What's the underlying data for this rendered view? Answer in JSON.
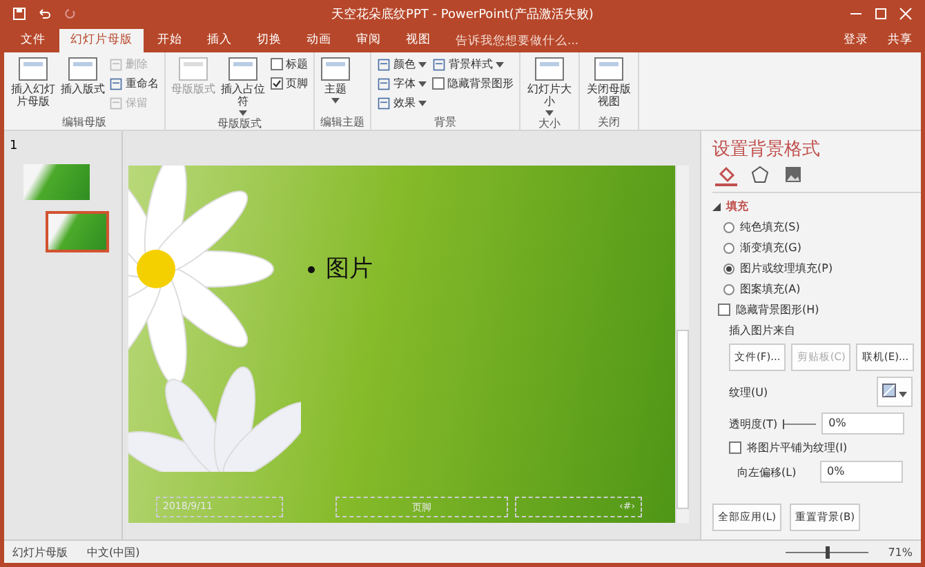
{
  "window": {
    "title": "天空花朵底纹PPT - PowerPoint(产品激活失败)"
  },
  "tabs": [
    {
      "label": "文件",
      "selected": false
    },
    {
      "label": "幻灯片母版",
      "selected": true
    },
    {
      "label": "开始",
      "selected": false
    },
    {
      "label": "插入",
      "selected": false
    },
    {
      "label": "切换",
      "selected": false
    },
    {
      "label": "动画",
      "selected": false
    },
    {
      "label": "审阅",
      "selected": false
    },
    {
      "label": "视图",
      "selected": false
    }
  ],
  "tell_me": {
    "placeholder": "告诉我您想要做什么..."
  },
  "account": {
    "login": "登录",
    "share": "共享"
  },
  "ribbon": [
    {
      "label": "编辑母版",
      "items": [
        {
          "kind": "large",
          "label": "插入幻灯片母版",
          "disabled": false
        },
        {
          "kind": "large",
          "label": "插入版式",
          "disabled": false
        },
        {
          "kind": "small",
          "label": "删除",
          "disabled": true
        },
        {
          "kind": "small",
          "label": "重命名",
          "disabled": false
        },
        {
          "kind": "small",
          "label": "保留",
          "disabled": true
        }
      ]
    },
    {
      "label": "母版版式",
      "items": [
        {
          "kind": "large",
          "label": "母版版式",
          "disabled": true
        },
        {
          "kind": "large",
          "label": "插入占位符",
          "disabled": false,
          "dropdown": true
        },
        {
          "kind": "check",
          "label": "标题",
          "checked": false
        },
        {
          "kind": "check",
          "label": "页脚",
          "checked": true
        }
      ]
    },
    {
      "label": "编辑主题",
      "items": [
        {
          "kind": "large",
          "label": "主题",
          "disabled": false,
          "dropdown": true
        }
      ]
    },
    {
      "label": "背景",
      "items": [
        {
          "kind": "small",
          "label": "颜色",
          "disabled": false,
          "dropdown": true
        },
        {
          "kind": "small",
          "label": "字体",
          "disabled": false,
          "dropdown": true
        },
        {
          "kind": "small",
          "label": "效果",
          "disabled": false,
          "dropdown": true
        },
        {
          "kind": "small",
          "label": "背景样式",
          "disabled": false,
          "dropdown": true
        },
        {
          "kind": "check",
          "label": "隐藏背景图形",
          "checked": false
        }
      ]
    },
    {
      "label": "大小",
      "items": [
        {
          "kind": "large",
          "label": "幻灯片大小",
          "disabled": false,
          "dropdown": true
        }
      ]
    },
    {
      "label": "关闭",
      "items": [
        {
          "kind": "large",
          "label": "关闭母版视图",
          "disabled": false
        }
      ]
    }
  ],
  "thumbnails": {
    "number": "1",
    "items": [
      {
        "kind": "master",
        "selected": false
      },
      {
        "kind": "layout",
        "selected": true
      }
    ]
  },
  "slide": {
    "bullet": "图片",
    "footers": [
      "2018/9/11",
      "页脚",
      "‹#›"
    ]
  },
  "pane": {
    "title": "设置背景格式",
    "tabs": [
      {
        "selected": true
      },
      {
        "selected": false
      },
      {
        "selected": false
      }
    ],
    "section": {
      "label": "填充",
      "expanded": true
    },
    "radios": [
      {
        "label": "纯色填充(S)",
        "selected": false
      },
      {
        "label": "渐变填充(G)",
        "selected": false
      },
      {
        "label": "图片或纹理填充(P)",
        "selected": true
      },
      {
        "label": "图案填充(A)",
        "selected": false
      }
    ],
    "hide_graphics": {
      "label": "隐藏背景图形(H)",
      "checked": false
    },
    "insert_from": "插入图片来自",
    "insert_buttons": [
      {
        "label": "文件(F)...",
        "disabled": false
      },
      {
        "label": "剪贴板(C)",
        "disabled": true
      },
      {
        "label": "联机(E)...",
        "disabled": false
      }
    ],
    "texture": "纹理(U)",
    "transparency": {
      "label": "透明度(T)",
      "level": 0,
      "value": "0%"
    },
    "tile": {
      "label": "将图片平铺为纹理(I)",
      "checked": false
    },
    "offset_left": {
      "label": "向左偏移(L)",
      "value": "0%"
    },
    "buttons": [
      "全部应用(L)",
      "重置背景(B)"
    ]
  },
  "status_bar": {
    "view": "幻灯片母版",
    "language": "中文(中国)",
    "zoom": {
      "value": "71%",
      "level": 0.5
    }
  }
}
